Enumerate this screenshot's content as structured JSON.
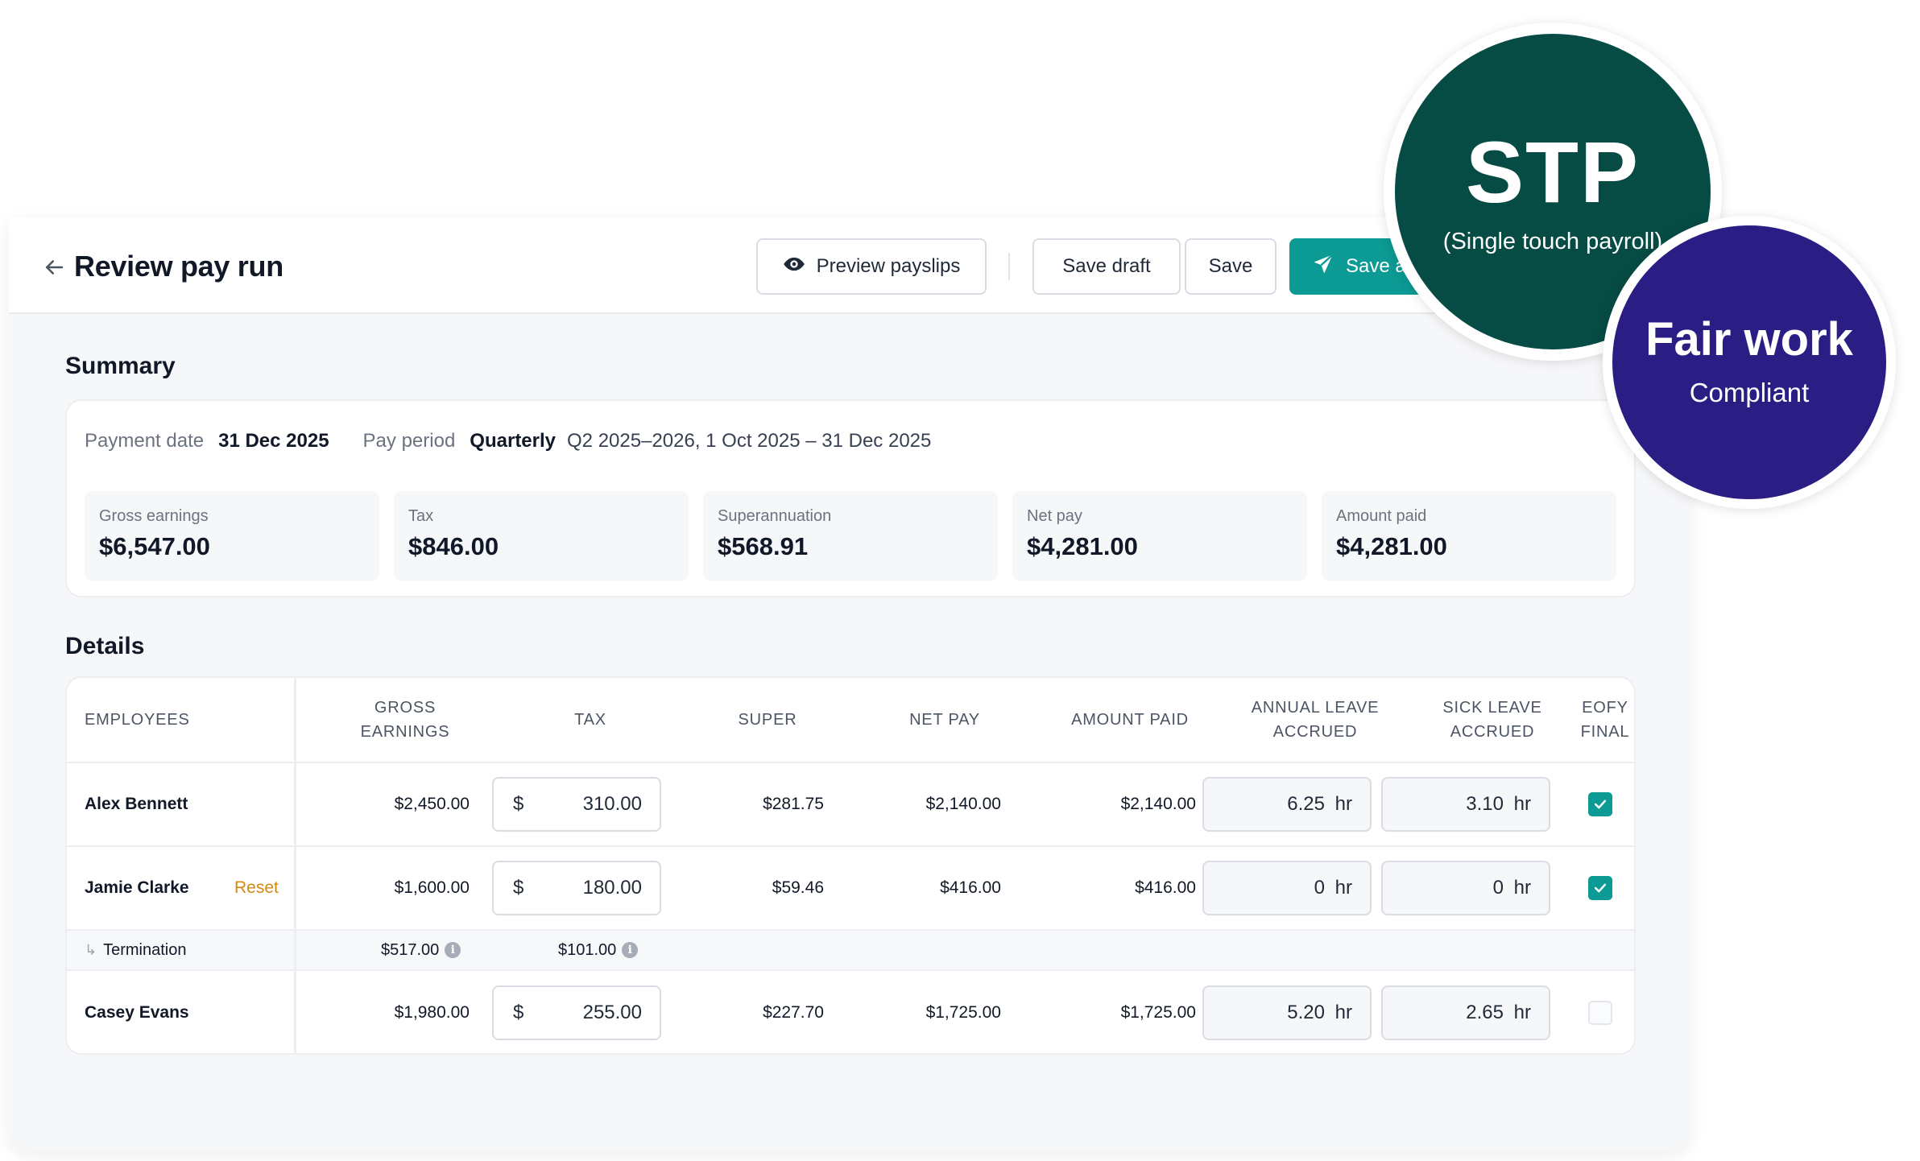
{
  "header": {
    "title": "Review pay run",
    "preview_label": "Preview payslips",
    "save_draft_label": "Save draft",
    "save_label": "Save",
    "save_submit_label": "Save a"
  },
  "summary": {
    "title": "Summary",
    "payment_date_label": "Payment date",
    "payment_date": "31 Dec 2025",
    "pay_period_label": "Pay period",
    "pay_period_type": "Quarterly",
    "pay_period_range": "Q2 2025–2026, 1 Oct 2025 – 31 Dec 2025",
    "stats": [
      {
        "label": "Gross earnings",
        "value": "$6,547.00"
      },
      {
        "label": "Tax",
        "value": "$846.00"
      },
      {
        "label": "Superannuation",
        "value": "$568.91"
      },
      {
        "label": "Net pay",
        "value": "$4,281.00"
      },
      {
        "label": "Amount paid",
        "value": "$4,281.00"
      }
    ]
  },
  "details": {
    "title": "Details",
    "columns": {
      "employees": "EMPLOYEES",
      "gross_1": "GROSS",
      "gross_2": "EARNINGS",
      "tax": "TAX",
      "super": "SUPER",
      "net_pay": "NET PAY",
      "amount_paid": "AMOUNT PAID",
      "annual_1": "ANNUAL LEAVE",
      "annual_2": "ACCRUED",
      "sick_1": "SICK LEAVE",
      "sick_2": "ACCRUED",
      "eofy_1": "EOFY",
      "eofy_2": "FINAL"
    },
    "currency": "$",
    "hr_unit": "hr",
    "reset_label": "Reset",
    "rows": [
      {
        "name": "Alex Bennett",
        "gross": "$2,450.00",
        "tax": "310.00",
        "super": "$281.75",
        "net": "$2,140.00",
        "paid": "$2,140.00",
        "annual": "6.25",
        "sick": "3.10",
        "eofy_final": true
      },
      {
        "name": "Jamie Clarke",
        "gross": "$1,600.00",
        "tax": "180.00",
        "super": "$59.46",
        "net": "$416.00",
        "paid": "$416.00",
        "annual": "0",
        "sick": "0",
        "eofy_final": true
      },
      {
        "name": "Casey Evans",
        "gross": "$1,980.00",
        "tax": "255.00",
        "super": "$227.70",
        "net": "$1,725.00",
        "paid": "$1,725.00",
        "annual": "5.20",
        "sick": "2.65",
        "eofy_final": false
      }
    ],
    "termination": {
      "label": "Termination",
      "gross": "$517.00",
      "tax": "$101.00"
    }
  },
  "badges": {
    "stp_title": "STP",
    "stp_subtitle": "(Single touch payroll)",
    "fairwork_title": "Fair work",
    "fairwork_subtitle": "Compliant"
  },
  "colors": {
    "accent": "#0c9a94",
    "stp_badge": "#064b44",
    "fairwork_badge": "#2a1d84",
    "reset": "#d68910"
  }
}
